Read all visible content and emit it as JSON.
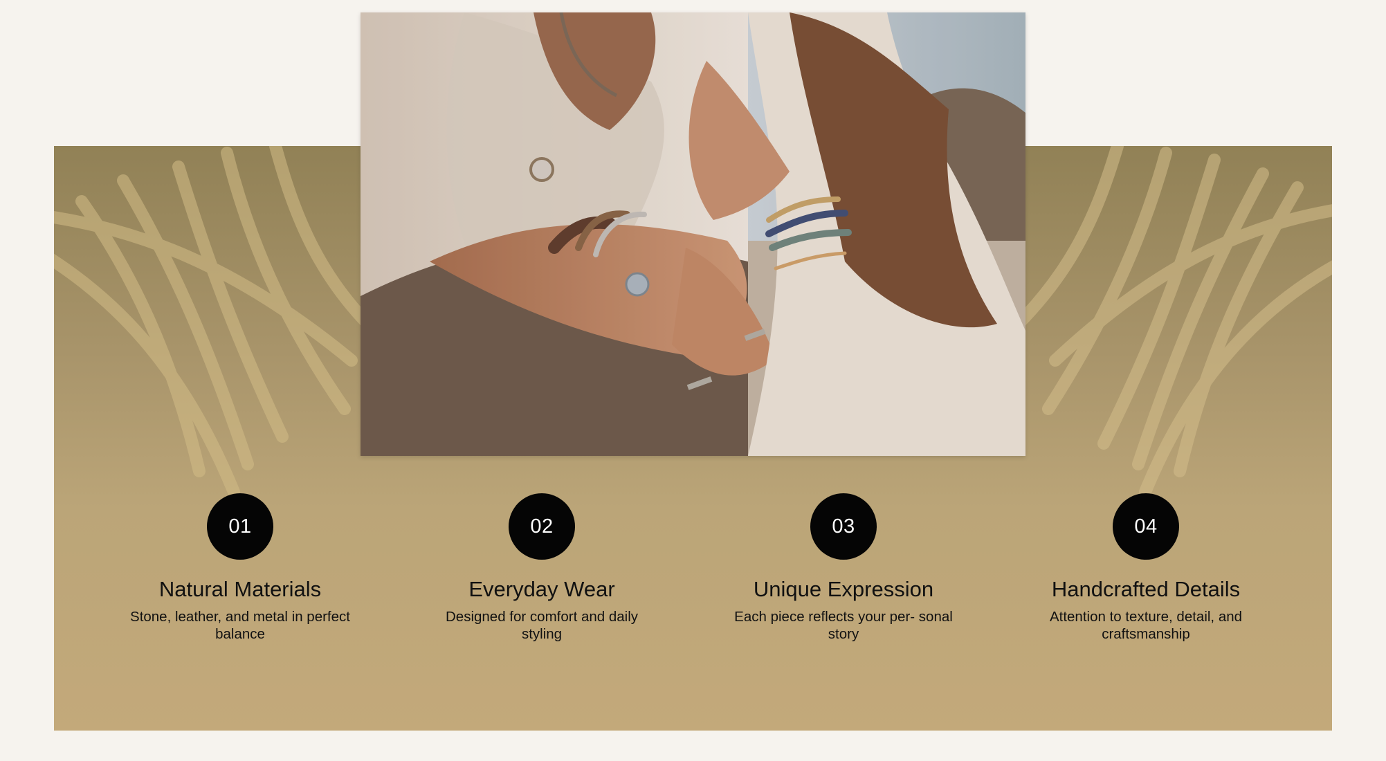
{
  "hero": {
    "image_alt": "Couple wearing bracelets and rings by the sea"
  },
  "features": [
    {
      "number": "01",
      "title": "Natural Materials",
      "description": "Stone, leather, and metal in perfect balance"
    },
    {
      "number": "02",
      "title": "Everyday Wear",
      "description": "Designed for comfort and daily styling"
    },
    {
      "number": "03",
      "title": "Unique Expression",
      "description": "Each piece reflects your per- sonal story"
    },
    {
      "number": "04",
      "title": "Handcrafted Details",
      "description": "Attention to texture, detail, and craftsmanship"
    }
  ],
  "colors": {
    "page_background": "#f6f3ee",
    "panel_tan": "#c3a97a",
    "circle_black": "#050505",
    "text_dark": "#111111"
  }
}
